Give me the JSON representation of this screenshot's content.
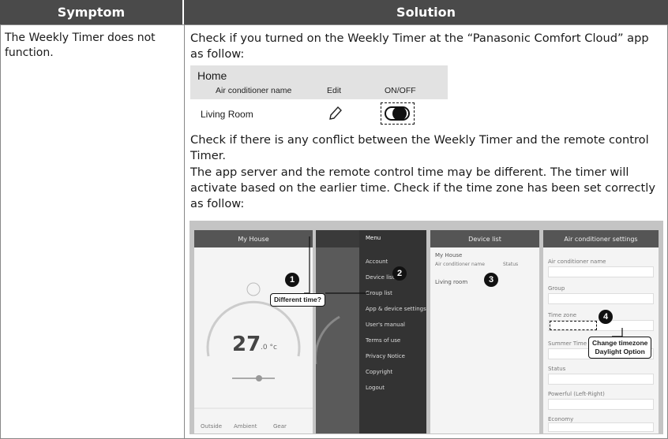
{
  "header": {
    "symptom": "Symptom",
    "solution": "Solution"
  },
  "symptom_text": "The Weekly Timer does not function.",
  "solution": {
    "para1": "Check if you turned on the Weekly Timer at the “Panasonic Comfort Cloud” app as follow:",
    "para2": "Check if there is any conflict between the Weekly Timer and the remote control Timer.",
    "para3": "The app server and the remote control time may be different. The timer will activate based on the earlier time. Check if the time zone has been set correctly as follow:"
  },
  "home_panel": {
    "title": "Home",
    "col_name": "Air conditioner name",
    "col_edit": "Edit",
    "col_onoff": "ON/OFF",
    "room": "Living Room",
    "toggle_on": true
  },
  "collage": {
    "screen1": {
      "title": "My House",
      "temperature": "27",
      "temp_unit": ".0 °c",
      "tabs": [
        "Outside",
        "Ambient",
        "Gear"
      ]
    },
    "screen2": {
      "menu_title": "Menu",
      "items": [
        "Account",
        "Device list",
        "Group list",
        "App & device settings",
        "User's manual",
        "Terms of use",
        "Privacy Notice",
        "Copyright",
        "Logout"
      ]
    },
    "screen3": {
      "title": "Device list",
      "group": "My House",
      "col1": "Air conditioner name",
      "col2": "Status",
      "room": "Living room"
    },
    "screen4": {
      "title": "Air conditioner settings",
      "rows": [
        "Air conditioner name",
        "Group",
        "Time zone",
        "Summer Time",
        "Status",
        "Powerful (Left-Right)",
        "Economy"
      ]
    },
    "badges": [
      "1",
      "2",
      "3",
      "4"
    ],
    "callout1": "Different time?",
    "callout2_line1": "Change timezone",
    "callout2_line2": "Daylight Option"
  }
}
